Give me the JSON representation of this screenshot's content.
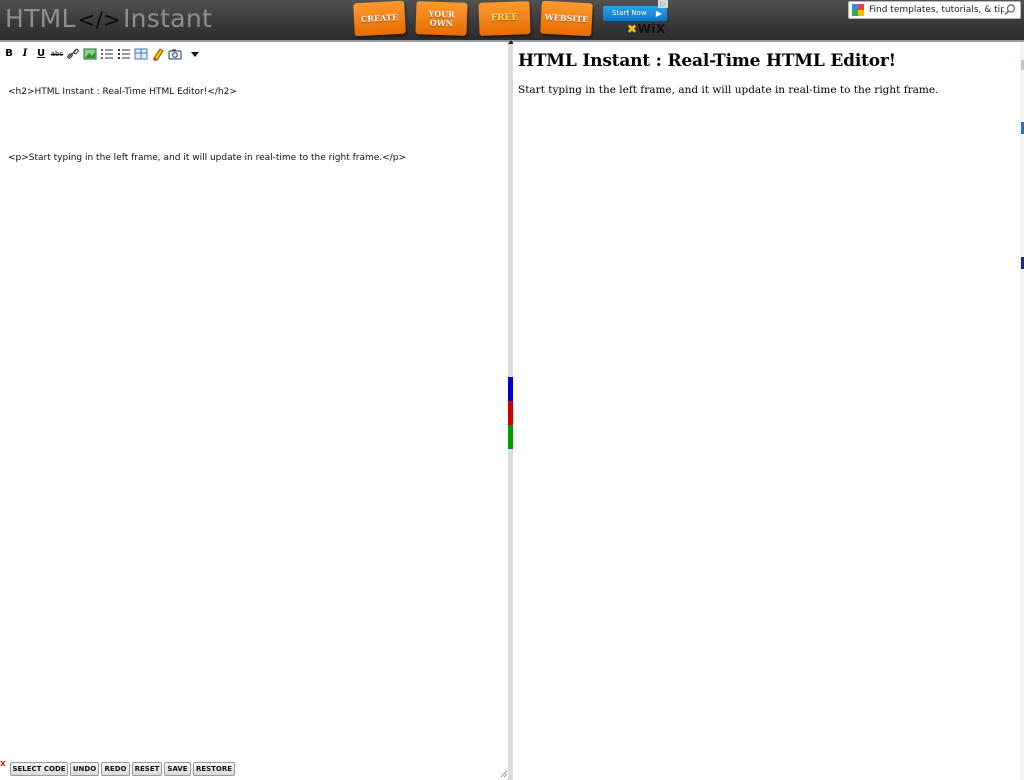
{
  "header": {
    "logo": {
      "left": "HTML",
      "tag": "</>",
      "right": "Instant"
    },
    "ad": {
      "tabs": [
        "CREATE",
        "YOUR",
        "OWN",
        "FREE",
        "WEBSITE"
      ],
      "start_now": "Start Now",
      "brand": "WiX"
    },
    "search": {
      "placeholder": "Find templates, tutorials, & tips"
    }
  },
  "toolbar": {
    "items": [
      "bold",
      "italic",
      "underline",
      "strikethrough",
      "link",
      "image",
      "unordered-list",
      "ordered-list",
      "table",
      "highlight",
      "preview",
      "dropdown"
    ],
    "bold_glyph": "B",
    "italic_glyph": "I",
    "underline_glyph": "U",
    "strike_glyph": "abc"
  },
  "editor": {
    "line1": "<h2>HTML Instant : Real-Time HTML Editor!</h2>",
    "line2": "<p>Start typing in the left frame, and it will update in real-time to the right frame.</p>"
  },
  "buttons": {
    "close": "x",
    "select_code": "SELECT CODE",
    "undo": "UNDO",
    "redo": "REDO",
    "reset": "RESET",
    "save": "SAVE",
    "restore": "RESTORE"
  },
  "preview": {
    "heading": "HTML Instant : Real-Time HTML Editor!",
    "paragraph": "Start typing in the left frame, and it will update in real-time to the right frame."
  },
  "colors": {
    "header_bg": "#3a3a3a",
    "ad_orange": "#f08a1a",
    "divider_blue": "#0000cc",
    "divider_red": "#cc0000",
    "divider_green": "#009900"
  }
}
